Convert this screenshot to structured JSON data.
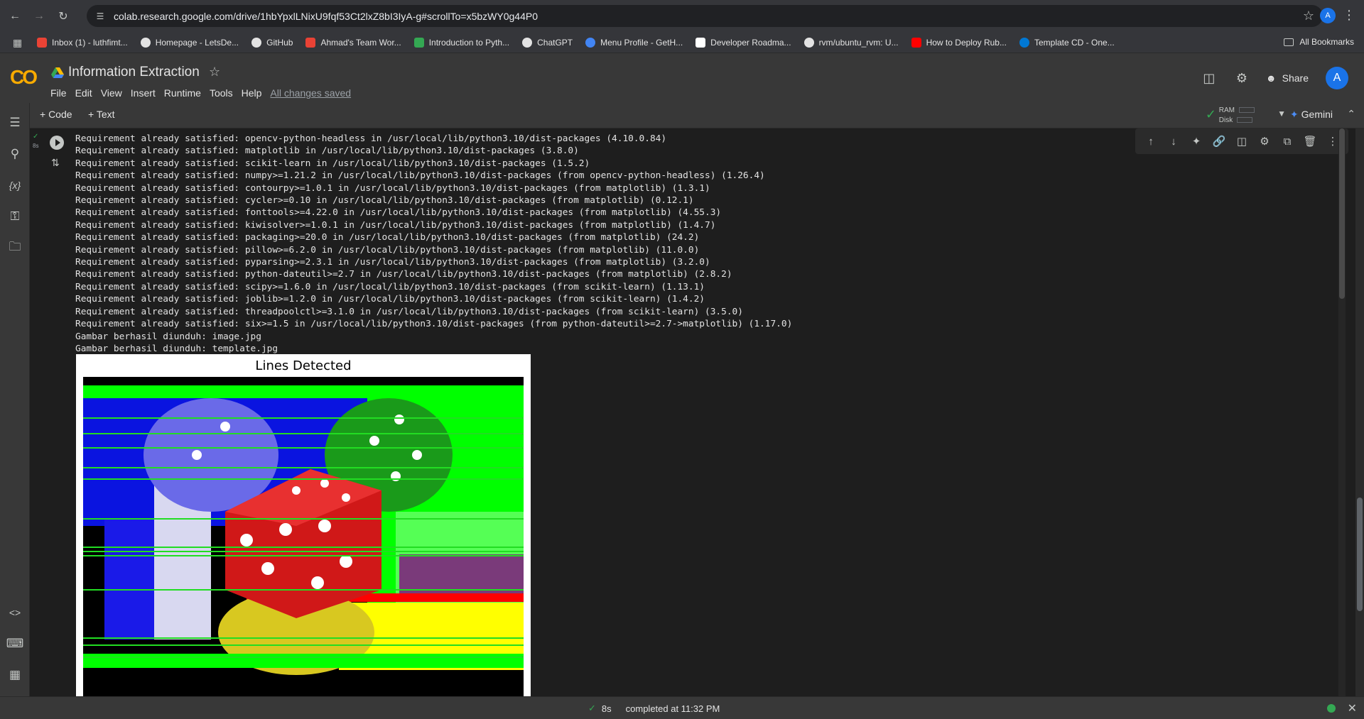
{
  "browser": {
    "url": "colab.research.google.com/drive/1hbYpxlLNixU9fqf53Ct2lxZ8bI3IyA-g#scrollTo=x5bzWY0g44P0",
    "profile_initial": "A"
  },
  "bookmarks": {
    "items": [
      {
        "label": "Inbox (1) - luthfimt...",
        "color": "#ea4335"
      },
      {
        "label": "Homepage - LetsDe...",
        "color": "#e3e3e3"
      },
      {
        "label": "GitHub",
        "color": "#e3e3e3"
      },
      {
        "label": "Ahmad's Team Wor...",
        "color": "#e94235"
      },
      {
        "label": "Introduction to Pyth...",
        "color": "#34a853"
      },
      {
        "label": "ChatGPT",
        "color": "#e3e3e3"
      },
      {
        "label": "Menu Profile - GetH...",
        "color": "#4285f4"
      },
      {
        "label": "Developer Roadma...",
        "color": "#ffffff"
      },
      {
        "label": "rvm/ubuntu_rvm: U...",
        "color": "#e3e3e3"
      },
      {
        "label": "How to Deploy Rub...",
        "color": "#ff0000"
      },
      {
        "label": "Template CD - One...",
        "color": "#0078d4"
      }
    ],
    "all_label": "All Bookmarks"
  },
  "colab": {
    "logo": "CO",
    "title": "Information Extraction",
    "menu": [
      "File",
      "Edit",
      "View",
      "Insert",
      "Runtime",
      "Tools",
      "Help"
    ],
    "saved_status": "All changes saved",
    "share_label": "Share",
    "avatar_initial": "A"
  },
  "toolbar": {
    "code_label": "+ Code",
    "text_label": "+ Text",
    "ram_label": "RAM",
    "disk_label": "Disk",
    "gemini_label": "Gemini"
  },
  "cell": {
    "exec_time": "8s",
    "output_lines": [
      "Requirement already satisfied: opencv-python-headless in /usr/local/lib/python3.10/dist-packages (4.10.0.84)",
      "Requirement already satisfied: matplotlib in /usr/local/lib/python3.10/dist-packages (3.8.0)",
      "Requirement already satisfied: scikit-learn in /usr/local/lib/python3.10/dist-packages (1.5.2)",
      "Requirement already satisfied: numpy>=1.21.2 in /usr/local/lib/python3.10/dist-packages (from opencv-python-headless) (1.26.4)",
      "Requirement already satisfied: contourpy>=1.0.1 in /usr/local/lib/python3.10/dist-packages (from matplotlib) (1.3.1)",
      "Requirement already satisfied: cycler>=0.10 in /usr/local/lib/python3.10/dist-packages (from matplotlib) (0.12.1)",
      "Requirement already satisfied: fonttools>=4.22.0 in /usr/local/lib/python3.10/dist-packages (from matplotlib) (4.55.3)",
      "Requirement already satisfied: kiwisolver>=1.0.1 in /usr/local/lib/python3.10/dist-packages (from matplotlib) (1.4.7)",
      "Requirement already satisfied: packaging>=20.0 in /usr/local/lib/python3.10/dist-packages (from matplotlib) (24.2)",
      "Requirement already satisfied: pillow>=6.2.0 in /usr/local/lib/python3.10/dist-packages (from matplotlib) (11.0.0)",
      "Requirement already satisfied: pyparsing>=2.3.1 in /usr/local/lib/python3.10/dist-packages (from matplotlib) (3.2.0)",
      "Requirement already satisfied: python-dateutil>=2.7 in /usr/local/lib/python3.10/dist-packages (from matplotlib) (2.8.2)",
      "Requirement already satisfied: scipy>=1.6.0 in /usr/local/lib/python3.10/dist-packages (from scikit-learn) (1.13.1)",
      "Requirement already satisfied: joblib>=1.2.0 in /usr/local/lib/python3.10/dist-packages (from scikit-learn) (1.4.2)",
      "Requirement already satisfied: threadpoolctl>=3.1.0 in /usr/local/lib/python3.10/dist-packages (from scikit-learn) (3.5.0)",
      "Requirement already satisfied: six>=1.5 in /usr/local/lib/python3.10/dist-packages (from python-dateutil>=2.7->matplotlib) (1.17.0)",
      "Gambar berhasil diunduh: image.jpg",
      "Gambar berhasil diunduh: template.jpg"
    ],
    "figure_title": "Lines Detected"
  },
  "status": {
    "duration": "8s",
    "completed": "completed at 11:32 PM"
  }
}
